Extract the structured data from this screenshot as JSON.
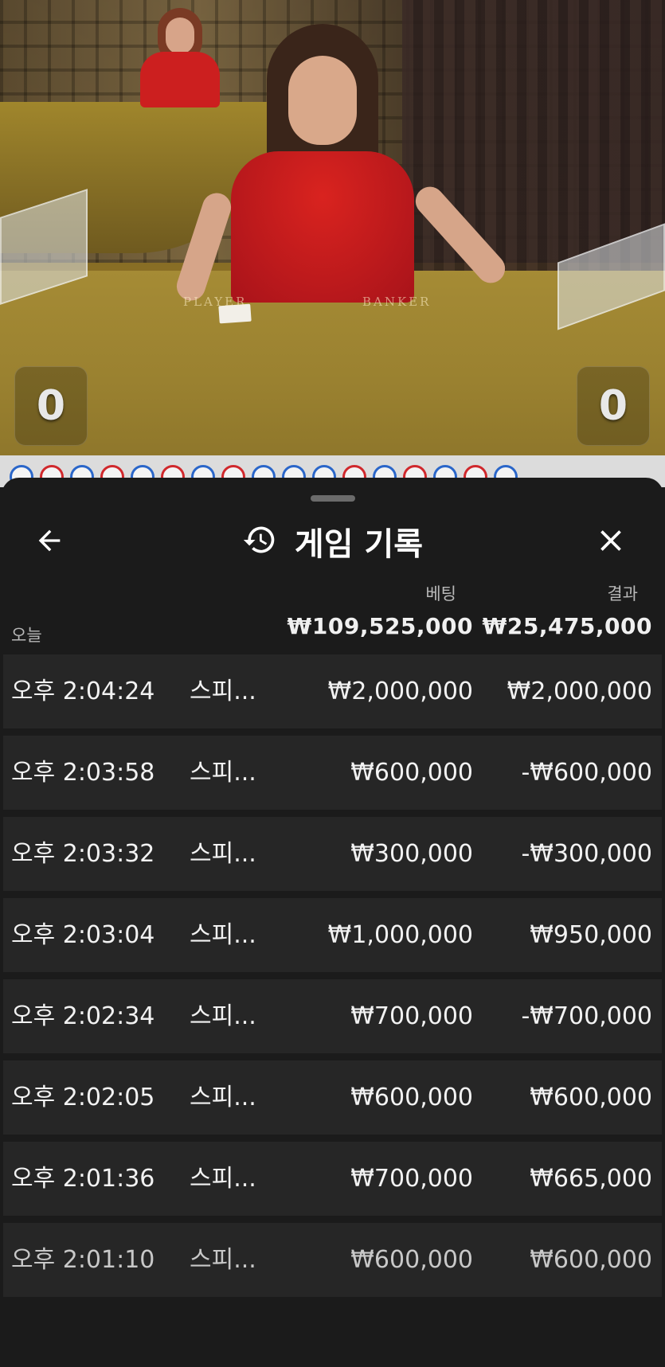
{
  "video": {
    "table_labels": {
      "player": "PLAYER",
      "banker": "BANKER"
    },
    "player_score": "0",
    "banker_score": "0"
  },
  "roadmap": {
    "results": [
      "P",
      "B",
      "P",
      "B",
      "P",
      "B",
      "P",
      "B",
      "P",
      "P",
      "P",
      "B",
      "P",
      "B",
      "P",
      "B",
      "P"
    ]
  },
  "sheet": {
    "title": "게임 기록",
    "icons": {
      "back": "arrow-left-icon",
      "history": "history-icon",
      "close": "close-icon"
    },
    "columns": {
      "bet": "베팅",
      "result": "결과"
    },
    "summary": {
      "label": "오늘",
      "bet_total": "₩109,525,000",
      "result_total": "₩25,475,000"
    },
    "rows": [
      {
        "time": "오후 2:04:24",
        "game": "스피...",
        "bet": "₩2,000,000",
        "result": "₩2,000,000"
      },
      {
        "time": "오후 2:03:58",
        "game": "스피...",
        "bet": "₩600,000",
        "result": "-₩600,000"
      },
      {
        "time": "오후 2:03:32",
        "game": "스피...",
        "bet": "₩300,000",
        "result": "-₩300,000"
      },
      {
        "time": "오후 2:03:04",
        "game": "스피...",
        "bet": "₩1,000,000",
        "result": "₩950,000"
      },
      {
        "time": "오후 2:02:34",
        "game": "스피...",
        "bet": "₩700,000",
        "result": "-₩700,000"
      },
      {
        "time": "오후 2:02:05",
        "game": "스피...",
        "bet": "₩600,000",
        "result": "₩600,000"
      },
      {
        "time": "오후 2:01:36",
        "game": "스피...",
        "bet": "₩700,000",
        "result": "₩665,000"
      },
      {
        "time": "오후 2:01:10",
        "game": "스피...",
        "bet": "₩600,000",
        "result": "₩600,000"
      }
    ]
  },
  "colors": {
    "player": "#2a66c9",
    "banker": "#d0282c",
    "sheet_bg": "#1b1b1b",
    "row_bg": "#262626"
  }
}
